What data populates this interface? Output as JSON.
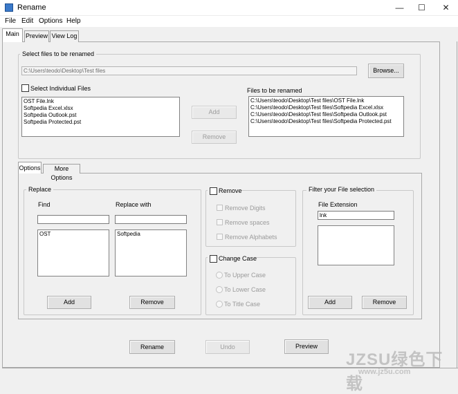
{
  "window": {
    "title": "Rename",
    "minimize": "—",
    "maximize": "☐",
    "close": "✕"
  },
  "menu": [
    "File",
    "Edit",
    "Options",
    "Help"
  ],
  "tabs": [
    "Main",
    "Preview",
    "View Log"
  ],
  "select_files": {
    "group_title": "Select files to be renamed",
    "path": "C:\\Users\\teodo\\Desktop\\Test files",
    "browse_label": "Browse...",
    "individual_label": "Select Individual Files",
    "source_files": [
      "OST File.lnk",
      "Softpedia Excel.xlsx",
      "Softpedia Outlook.pst",
      "Softpedia Protected.pst"
    ],
    "add_label": "Add",
    "remove_label": "Remove",
    "files_to_rename_label": "Files to be renamed",
    "files_to_rename": [
      "C:\\Users\\teodo\\Desktop\\Test files\\OST File.lnk",
      "C:\\Users\\teodo\\Desktop\\Test files\\Softpedia Excel.xlsx",
      "C:\\Users\\teodo\\Desktop\\Test files\\Softpedia Outlook.pst",
      "C:\\Users\\teodo\\Desktop\\Test files\\Softpedia Protected.pst"
    ]
  },
  "sub_tabs": [
    "Options",
    "More Options"
  ],
  "replace": {
    "group_title": "Replace",
    "find_label": "Find",
    "replace_label": "Replace with",
    "find_input": "",
    "replace_input": "",
    "find_list": [
      "OST"
    ],
    "replace_list": [
      "Softpedia"
    ],
    "add_label": "Add",
    "remove_label": "Remove"
  },
  "remove": {
    "group_title": "Remove",
    "options": [
      "Remove Digits",
      "Remove spaces",
      "Remove Alphabets"
    ]
  },
  "change_case": {
    "group_title": "Change Case",
    "options": [
      "To Upper Case",
      "To Lower Case",
      "To Title Case"
    ]
  },
  "filter": {
    "group_title": "Filter your File selection",
    "ext_label": "File Extension",
    "ext_input": "lnk",
    "ext_list": [],
    "add_label": "Add",
    "remove_label": "Remove"
  },
  "actions": {
    "rename": "Rename",
    "undo": "Undo",
    "preview": "Preview"
  },
  "watermark": {
    "main": "JZSU绿色下载",
    "sub": "www.jz5u.com"
  }
}
